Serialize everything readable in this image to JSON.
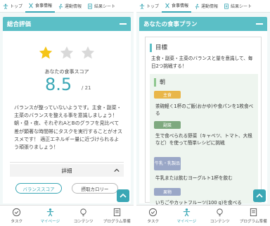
{
  "top_tabs": [
    {
      "label": "トップ",
      "icon": "figure-icon"
    },
    {
      "label": "食事情報",
      "icon": "fork-knife-icon"
    },
    {
      "label": "運動情報",
      "icon": "runner-icon"
    },
    {
      "label": "結果シート",
      "icon": "document-icon"
    }
  ],
  "left": {
    "section_title": "総合評価",
    "stars": {
      "filled": 1,
      "total": 3
    },
    "score_label": "あなたの食事スコア",
    "score": "8.5",
    "score_max": "/ 21",
    "comment": "バランスが整っていないようです。主食・副菜・主菜のバランスを整える事を意識しましょう！ 朝・昼・夜、それぞれAとBのグラフを見比べて差が顕著な時間帯にタスクを実行することがオススメです！ 適正エネルギー量に近づけられるよう頑張りましょう！",
    "details_label": "詳細",
    "pill_a": "バランススコア",
    "pill_b": "摂取カロリー"
  },
  "right": {
    "section_title": "あなたの食事プラン",
    "goal_title": "目標",
    "goal_text": "主食・副菜・主菜のバランスと量を意識して、毎日2つ挑戦する！",
    "meal_title": "朝",
    "items": [
      {
        "tag": "主食",
        "text": "茶碗軽く1杯のご飯(おかゆ)や食パンを1枚食べる"
      },
      {
        "tag": "副菜",
        "text": "生で食べられる野菜（キャベツ、トマト、大根など）を使って簡単レシピに挑戦"
      },
      {
        "tag": "牛乳・乳製品",
        "text": "牛乳または飲むヨーグルト1杯を飲む"
      },
      {
        "tag": "果物",
        "text": "いちごやカットフルーツ(100 g)を食べる"
      }
    ]
  },
  "bottom_nav": [
    {
      "label": "タスク",
      "icon": "check-circle-icon"
    },
    {
      "label": "マイページ",
      "icon": "person-icon"
    },
    {
      "label": "コンテンツ",
      "icon": "bulb-icon"
    },
    {
      "label": "プログラム準備",
      "icon": "book-icon"
    }
  ],
  "colors": {
    "accent": "#3aa7b5",
    "header": "#5bbfc6",
    "star": "#f5c518",
    "tag_staple": "#e9b649",
    "tag_side": "#7ea97f",
    "tag_milk": "#9aa7c7"
  }
}
